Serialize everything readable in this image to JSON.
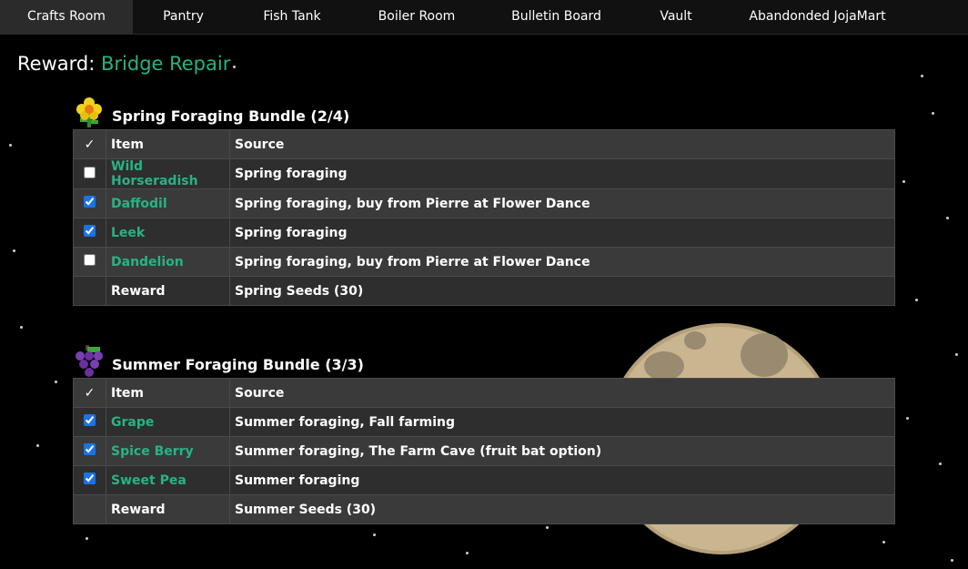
{
  "tabs": [
    {
      "label": "Crafts Room",
      "active": true
    },
    {
      "label": "Pantry"
    },
    {
      "label": "Fish Tank"
    },
    {
      "label": "Boiler Room"
    },
    {
      "label": "Bulletin Board"
    },
    {
      "label": "Vault"
    },
    {
      "label": "Abandonded JojaMart"
    }
  ],
  "reward": {
    "label": "Reward:",
    "value": "Bridge Repair"
  },
  "columns": {
    "check": "✓",
    "item": "Item",
    "source": "Source"
  },
  "bundles": [
    {
      "title": "Spring Foraging Bundle (2/4)",
      "icon": "daffodil-icon",
      "items": [
        {
          "name": "Wild Horseradish",
          "source": "Spring foraging",
          "checked": false
        },
        {
          "name": "Daffodil",
          "source": "Spring foraging, buy from Pierre at Flower Dance",
          "checked": true
        },
        {
          "name": "Leek",
          "source": "Spring foraging",
          "checked": true
        },
        {
          "name": "Dandelion",
          "source": "Spring foraging, buy from Pierre at Flower Dance",
          "checked": false
        }
      ],
      "reward_label": "Reward",
      "reward_value": "Spring Seeds (30)"
    },
    {
      "title": "Summer Foraging Bundle (3/3)",
      "icon": "grape-icon",
      "items": [
        {
          "name": "Grape",
          "source": "Summer foraging, Fall farming",
          "checked": true
        },
        {
          "name": "Spice Berry",
          "source": "Summer foraging, The Farm Cave (fruit bat option)",
          "checked": true
        },
        {
          "name": "Sweet Pea",
          "source": "Summer foraging",
          "checked": true
        }
      ],
      "reward_label": "Reward",
      "reward_value": "Summer Seeds (30)"
    }
  ],
  "colors": {
    "accent": "#27b386",
    "background": "#000000",
    "row_dark": "#2e2e2e",
    "row_light": "#3a3a3a"
  }
}
